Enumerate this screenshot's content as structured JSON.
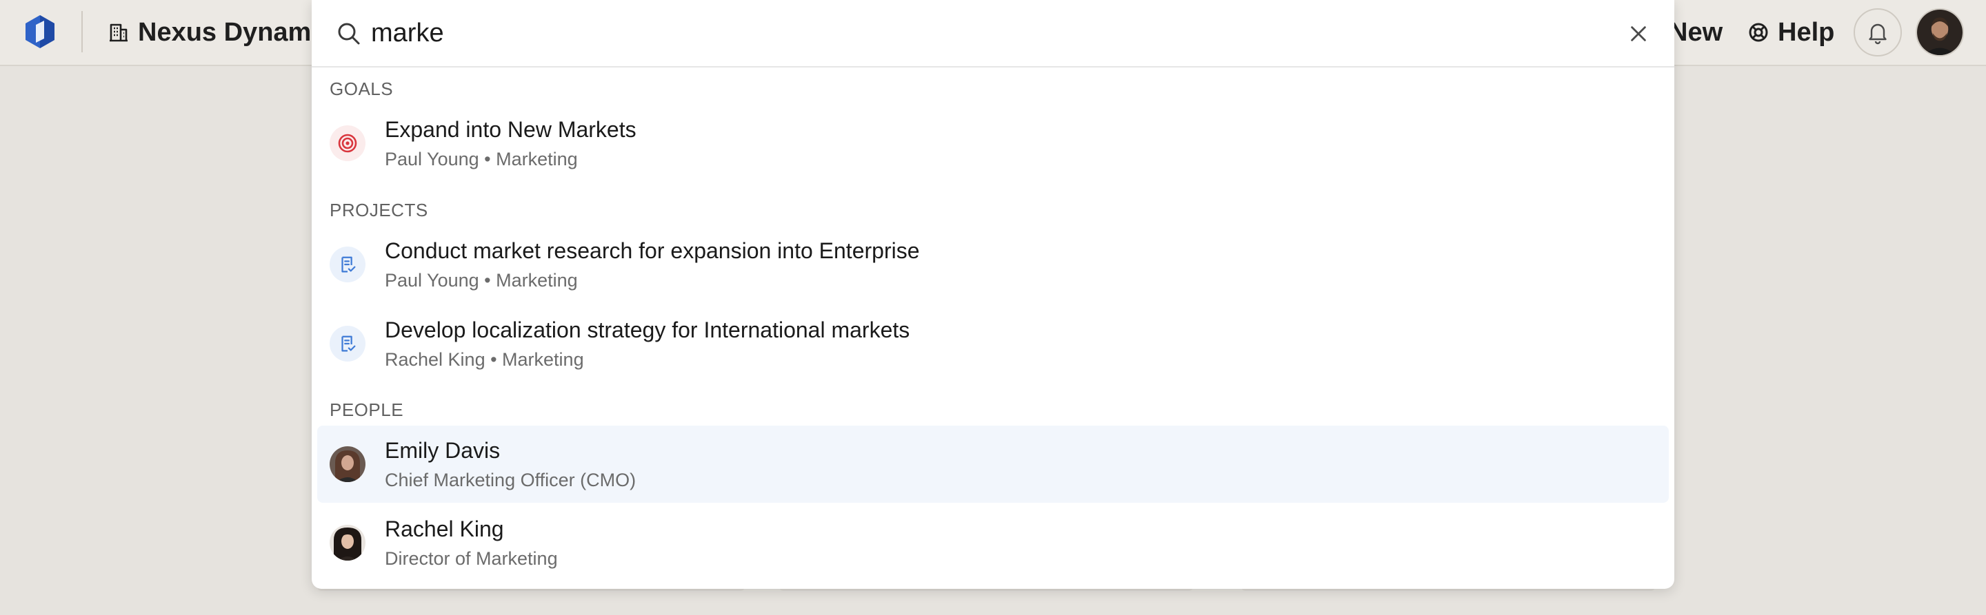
{
  "topbar": {
    "company_name": "Nexus Dynamics",
    "new_label": "New",
    "help_label": "Help"
  },
  "search": {
    "value": "marke",
    "placeholder": ""
  },
  "results": {
    "goals": {
      "label": "GOALS",
      "items": [
        {
          "title": "Expand into New Markets",
          "subtitle": "Paul Young • Marketing"
        }
      ]
    },
    "projects": {
      "label": "PROJECTS",
      "items": [
        {
          "title": "Conduct market research for expansion into Enterprise",
          "subtitle": "Paul Young • Marketing"
        },
        {
          "title": "Develop localization strategy for International markets",
          "subtitle": "Rachel King • Marketing"
        }
      ]
    },
    "people": {
      "label": "PEOPLE",
      "items": [
        {
          "name": "Emily Davis",
          "role": "Chief Marketing Officer (CMO)"
        },
        {
          "name": "Rachel King",
          "role": "Director of Marketing"
        }
      ]
    }
  },
  "colors": {
    "accent_red": "#d9363e",
    "accent_blue": "#3f7bd6",
    "logo_blue": "#2f63c8",
    "highlight_row": "#f2f6fc"
  },
  "icons": {
    "logo": "company-logo-icon",
    "company": "building-icon",
    "help": "lifebuoy-icon",
    "bell": "bell-icon",
    "search": "search-icon",
    "clear": "close-icon",
    "goal": "target-icon",
    "project": "checklist-icon"
  }
}
